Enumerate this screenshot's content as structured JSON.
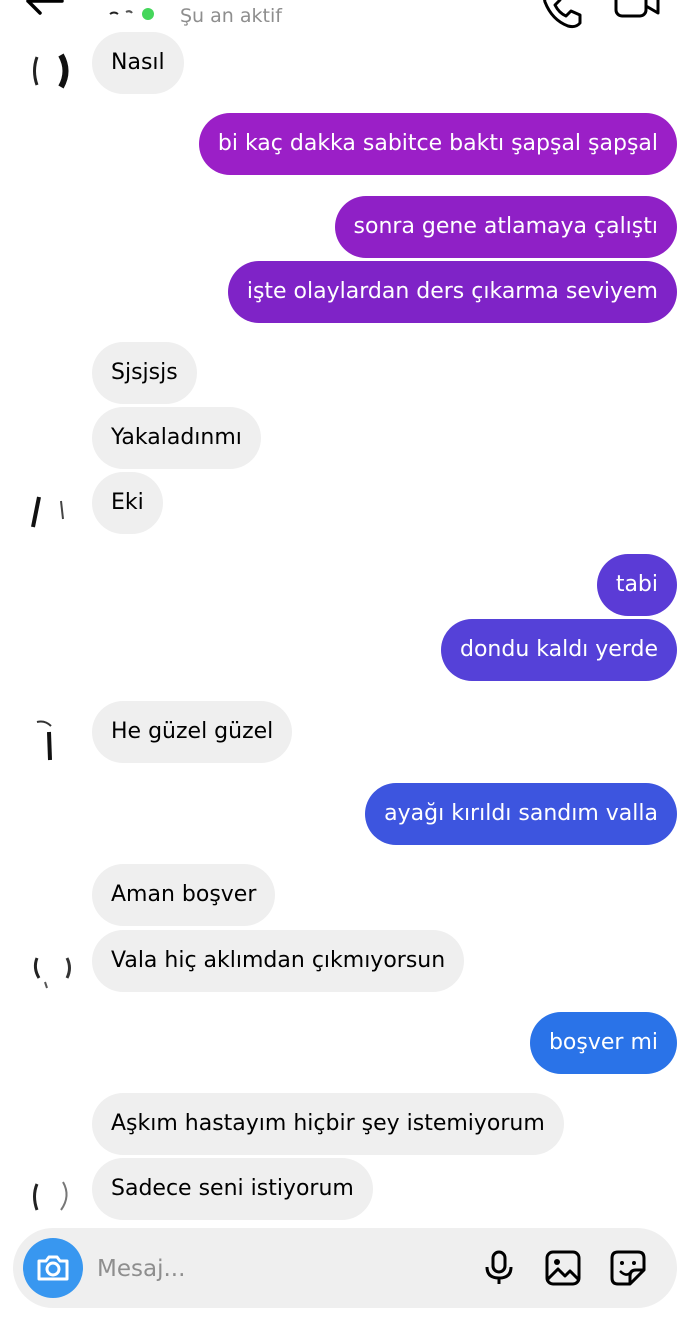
{
  "header": {
    "status": "Şu an aktif"
  },
  "messages": [
    {
      "side": "in",
      "text": "Nasıl"
    },
    {
      "side": "out",
      "text": "bi kaç dakka sabitce baktı şapşal şapşal",
      "color": "#9b1fc7"
    },
    {
      "side": "out",
      "text": "sonra gene atlamaya çalıştı",
      "color": "#8f20c6"
    },
    {
      "side": "out",
      "text": "işte olaylardan ders çıkarma seviyem",
      "color": "#7f23c7"
    },
    {
      "side": "in",
      "text": "Sjsjsjs"
    },
    {
      "side": "in",
      "text": "Yakaladınmı"
    },
    {
      "side": "in",
      "text": "Eki"
    },
    {
      "side": "out",
      "text": "tabi",
      "color": "#5b3bd6"
    },
    {
      "side": "out",
      "text": "dondu kaldı yerde",
      "color": "#5541d8"
    },
    {
      "side": "in",
      "text": "He güzel güzel"
    },
    {
      "side": "out",
      "text": "ayağı kırıldı sandım valla",
      "color": "#3d55df"
    },
    {
      "side": "in",
      "text": "Aman boşver"
    },
    {
      "side": "in",
      "text": "Vala hiç aklımdan çıkmıyorsun"
    },
    {
      "side": "out",
      "text": "boşver mi",
      "color": "#2a73e8"
    },
    {
      "side": "in",
      "text": "Aşkım hastayım hiçbir şey istemiyorum"
    },
    {
      "side": "in",
      "text": "Sadece seni istiyorum"
    }
  ],
  "composer": {
    "placeholder": "Mesaj...",
    "camera_icon": "camera-icon",
    "mic_icon": "microphone-icon",
    "gallery_icon": "gallery-icon",
    "sticker_icon": "sticker-icon"
  },
  "colors": {
    "incoming_bubble": "#efefef",
    "camera_button": "#3897f0"
  }
}
